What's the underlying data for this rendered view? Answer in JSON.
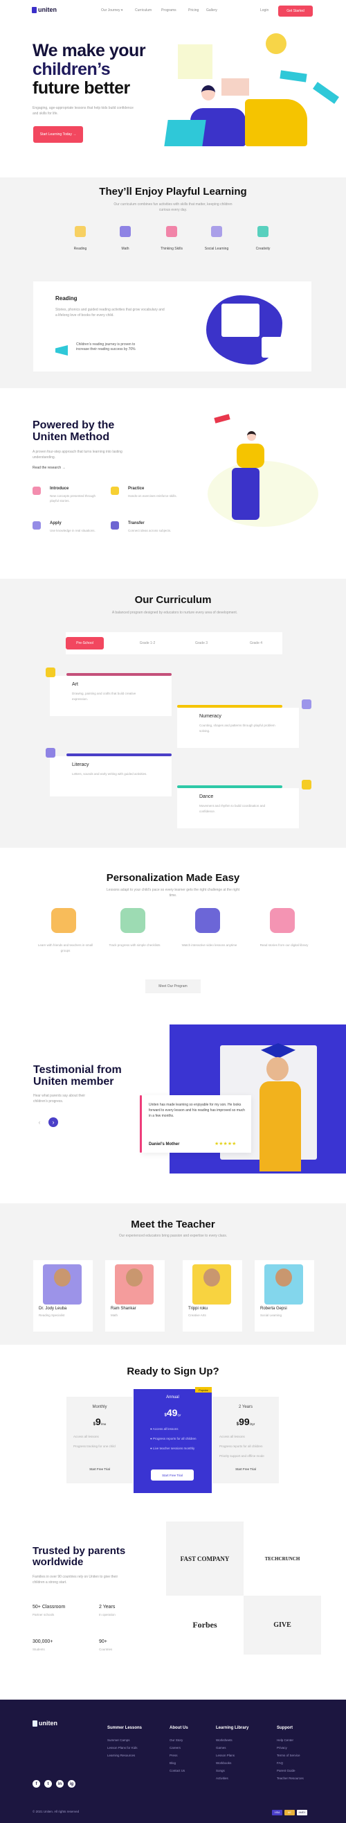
{
  "header": {
    "logo": "uniten",
    "nav": [
      "Our Journey ▾",
      "Curriculum",
      "Programs",
      "Pricing",
      "Gallery"
    ],
    "login": "Login",
    "cta": "Get Started"
  },
  "hero": {
    "title_line1": "We make your",
    "title_line2": "children’s",
    "title_line3": "future better",
    "subtitle": "Engaging, age-appropriate lessons that help kids build confidence and skills for life.",
    "cta": "Start Learning Today →"
  },
  "playful": {
    "title": "They’ll Enjoy Playful Learning",
    "subtitle": "Our curriculum combines fun activities with skills that matter, keeping children curious every day.",
    "categories": [
      {
        "label": "Reading",
        "color": "#f7c948"
      },
      {
        "label": "Math",
        "color": "#7b6fe0"
      },
      {
        "label": "Thinking Skills",
        "color": "#f0709a"
      },
      {
        "label": "Social Learning",
        "color": "#9c8fe6"
      },
      {
        "label": "Creativity",
        "color": "#3cc9b4"
      }
    ],
    "detail": {
      "title": "Reading",
      "text": "Stories, phonics and guided reading activities that grow vocabulary and a lifelong love of books for every child.",
      "note": "Children’s reading journey is proven to increase their reading success by 70%"
    }
  },
  "method": {
    "title_line1": "Powered by the",
    "title_line2": "Uniten Method",
    "subtitle": "A proven four-step approach that turns learning into lasting understanding.",
    "link": "Read the research →",
    "steps": [
      {
        "title": "Introduce",
        "text": "New concepts presented through playful stories."
      },
      {
        "title": "Practice",
        "text": "Hands-on exercises reinforce skills."
      },
      {
        "title": "Apply",
        "text": "Use knowledge in real situations."
      },
      {
        "title": "Transfer",
        "text": "Connect ideas across subjects."
      }
    ]
  },
  "curriculum": {
    "title": "Our Curriculum",
    "subtitle": "A balanced program designed by educators to nurture every area of development.",
    "tabs": [
      "Pre-School",
      "Grade 1-2",
      "Grade 3",
      "Grade 4"
    ],
    "active_tab": 0,
    "cards": [
      {
        "title": "Art",
        "color": "#c4507a",
        "text": "Drawing, painting and crafts that build creative expression."
      },
      {
        "title": "Numeracy",
        "color": "#f5c400",
        "text": "Counting, shapes and patterns through playful problem solving."
      },
      {
        "title": "Literacy",
        "color": "#4a3fc7",
        "text": "Letters, sounds and early writing with guided activities."
      },
      {
        "title": "Dance",
        "color": "#2ec9a7",
        "text": "Movement and rhythm to build coordination and confidence."
      }
    ]
  },
  "personalization": {
    "title": "Personalization Made Easy",
    "subtitle": "Lessons adapt to your child’s pace so every learner gets the right challenge at the right time.",
    "items": [
      "Learn with friends and teachers in small groups",
      "Track progress with simple checklists",
      "Watch interactive video lessons anytime",
      "Read stories from our digital library"
    ],
    "cta": "Meet Our Program"
  },
  "testimonial": {
    "title_line1": "Testimonial from",
    "title_line2": "Uniten member",
    "subtitle": "Hear what parents say about their children’s progress.",
    "quote": "Uniten has made learning so enjoyable for my son. He looks forward to every lesson and his reading has improved so much in a few months.",
    "author": "Daniel’s Mother",
    "rating": 5,
    "rating_max": 5,
    "stars": "★★★★★",
    "prev": "‹",
    "next": "›"
  },
  "teachers": {
    "title": "Meet the Teacher",
    "subtitle": "Our experienced educators bring passion and expertise to every class.",
    "list": [
      {
        "name": "Dr. Jody Leuba",
        "role": "Reading Specialist",
        "bg": "#7b6fe0"
      },
      {
        "name": "Ram Shankar",
        "role": "Math",
        "bg": "#f07b7b"
      },
      {
        "name": "Trippi roku",
        "role": "Creative Arts",
        "bg": "#f5c400"
      },
      {
        "name": "Roberta Gepsi",
        "role": "Social Learning",
        "bg": "#5ac8e6"
      }
    ]
  },
  "pricing": {
    "title": "Ready to Sign Up?",
    "plans": [
      {
        "name": "Monthly",
        "currency": "$",
        "price": "9",
        "period": "/mo",
        "features": [
          "Access all lessons",
          "Progress tracking for one child"
        ],
        "cta": "Start Free Trial"
      },
      {
        "name": "Annual",
        "currency": "$",
        "price": "49",
        "period": "/yr",
        "badge": "Popular",
        "features": [
          "Access all lessons",
          "Progress reports for all children",
          "Live teacher sessions monthly"
        ],
        "cta": "Start Free Trial"
      },
      {
        "name": "2 Years",
        "currency": "$",
        "price": "99",
        "period": "/2yr",
        "features": [
          "Access all lessons",
          "Progress reports for all children",
          "Priority support and offline mode"
        ],
        "cta": "Start Free Trial"
      }
    ]
  },
  "trusted": {
    "title_line1": "Trusted by parents",
    "title_line2": "worldwide",
    "subtitle": "Families in over 90 countries rely on Uniten to give their children a strong start.",
    "stats": [
      {
        "value": "50+ Classroom",
        "label": "Partner schools"
      },
      {
        "value": "2 Years",
        "label": "In operation"
      },
      {
        "value": "300,000+",
        "label": "Students"
      },
      {
        "value": "90+",
        "label": "Countries"
      }
    ],
    "logos": [
      "FAST COMPANY",
      "TECHCRUNCH",
      "Forbes",
      "GIVE"
    ]
  },
  "footer": {
    "logo": "uniten",
    "columns": [
      {
        "title": "Summer Lessons",
        "links": [
          "Summer Camps",
          "Lesson Plans for Kids",
          "Learning Resources"
        ]
      },
      {
        "title": "About Us",
        "links": [
          "Our Story",
          "Careers",
          "Press",
          "Blog",
          "Contact Us"
        ]
      },
      {
        "title": "Learning Library",
        "links": [
          "Worksheets",
          "Games",
          "Lesson Plans",
          "Workbooks",
          "Songs",
          "Activities"
        ]
      },
      {
        "title": "Support",
        "links": [
          "Help Center",
          "Privacy",
          "Terms of Service",
          "FAQ",
          "Parent Guide",
          "Teacher Resources"
        ]
      }
    ],
    "social": [
      "f",
      "t",
      "in",
      "ig"
    ],
    "copyright": "© 2021 Uniten. All rights reserved",
    "payments": [
      "VISA",
      "MC",
      "AMEX"
    ]
  }
}
